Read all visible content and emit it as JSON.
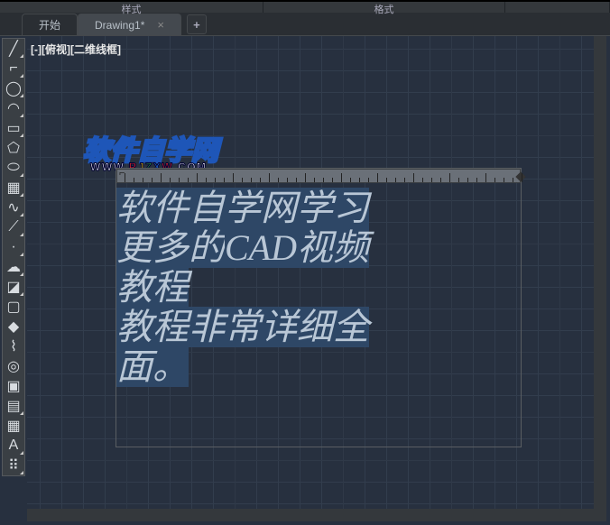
{
  "menubar": {
    "item1": "样式",
    "item2": "格式"
  },
  "tabs": {
    "start": "开始",
    "drawing": "Drawing1*",
    "close": "×",
    "new": "+"
  },
  "view_label": "[-][俯视][二维线框]",
  "watermark": {
    "main": "软件自学网",
    "sub_parts": [
      "WWW.",
      "R",
      "J",
      "Z",
      "X",
      "W",
      ".COM"
    ],
    "sub_colors": [
      "#ffffff",
      "#ff2a2a",
      "#ffd400",
      "#37d337",
      "#2a8cff",
      "#ff2a2a",
      "#ffffff"
    ]
  },
  "text_content": {
    "line1": "软件自学网学习",
    "line2a": "更多的",
    "line2b": "CAD",
    "line2c": "视频",
    "line3": "教程",
    "line4": "教程非常详细全",
    "line5": "面。"
  },
  "tools": [
    {
      "name": "line",
      "glyph": "╱",
      "fly": true
    },
    {
      "name": "polyline",
      "glyph": "⌐",
      "fly": true
    },
    {
      "name": "circle",
      "glyph": "◯",
      "fly": true
    },
    {
      "name": "arc",
      "glyph": "◠",
      "fly": true
    },
    {
      "name": "rectangle",
      "glyph": "▭",
      "fly": true
    },
    {
      "name": "polygon",
      "glyph": "⬠",
      "fly": false
    },
    {
      "name": "ellipse",
      "glyph": "⬭",
      "fly": true
    },
    {
      "name": "hatch",
      "glyph": "▦",
      "fly": true
    },
    {
      "name": "spline",
      "glyph": "∿",
      "fly": true
    },
    {
      "name": "construction",
      "glyph": "⟋",
      "fly": true
    },
    {
      "name": "point",
      "glyph": "·",
      "fly": true
    },
    {
      "name": "revcloud",
      "glyph": "☁",
      "fly": true
    },
    {
      "name": "region",
      "glyph": "◪",
      "fly": true
    },
    {
      "name": "wipeout",
      "glyph": "▢",
      "fly": false
    },
    {
      "name": "3dface",
      "glyph": "◆",
      "fly": false
    },
    {
      "name": "helix",
      "glyph": "⌇",
      "fly": false
    },
    {
      "name": "donut",
      "glyph": "◎",
      "fly": false
    },
    {
      "name": "boundary",
      "glyph": "▣",
      "fly": false
    },
    {
      "name": "measure",
      "glyph": "▤",
      "fly": true
    },
    {
      "name": "table",
      "glyph": "▦",
      "fly": false
    },
    {
      "name": "text",
      "glyph": "A",
      "fly": true
    },
    {
      "name": "more",
      "glyph": "⠿",
      "fly": true
    }
  ]
}
